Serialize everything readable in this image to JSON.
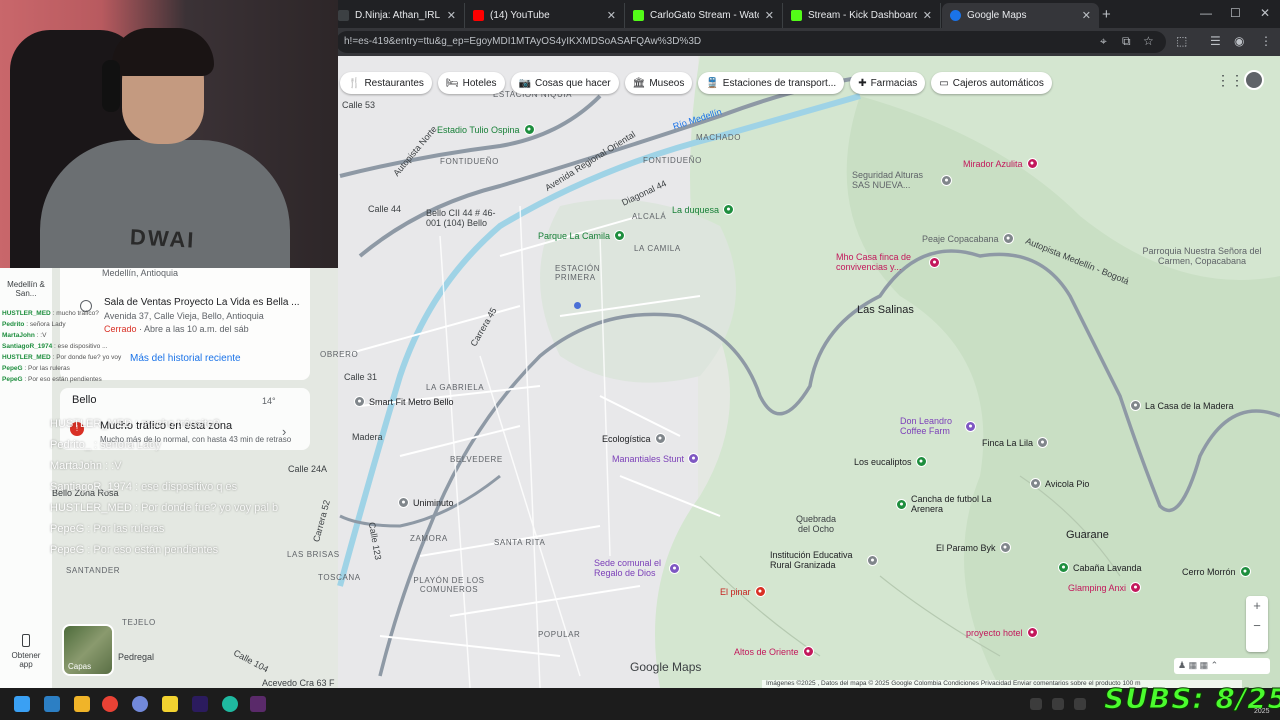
{
  "browser": {
    "tabs": [
      {
        "label": "D.Ninja: Athan_IRL",
        "color": "#3c4043"
      },
      {
        "label": "(14) YouTube",
        "color": "#ff0000"
      },
      {
        "label": "CarloGato Stream - Watch Live",
        "color": "#53fc18"
      },
      {
        "label": "Stream - Kick Dashboard",
        "color": "#53fc18"
      },
      {
        "label": "Google Maps",
        "color": "#1a73e8"
      }
    ],
    "url": "h!=es-419&entry=ttu&g_ep=EgoyMDI1MTAyOS4yIKXMDSoASAFQAw%3D%3D"
  },
  "chips": [
    {
      "label": "Restaurantes",
      "icon": "fork-knife-icon"
    },
    {
      "label": "Hoteles",
      "icon": "bed-icon"
    },
    {
      "label": "Cosas que hacer",
      "icon": "camera-icon"
    },
    {
      "label": "Museos",
      "icon": "museum-icon"
    },
    {
      "label": "Estaciones de transport...",
      "icon": "train-icon"
    },
    {
      "label": "Farmacias",
      "icon": "pharmacy-icon"
    },
    {
      "label": "Cajeros automáticos",
      "icon": "atm-icon"
    }
  ],
  "webcam": {
    "hoodie_text": "DWAI"
  },
  "panel": {
    "nav_label": "Medellín & San...",
    "history_top": "Medellín, Antioquia",
    "history_place": "Sala de Ventas Proyecto La Vida es Bella ...",
    "history_addr": "Avenida 37, Calle Vieja, Bello, Antioquia",
    "history_closed": "Cerrado",
    "history_hours": " · Abre a las 10 a.m. del sáb",
    "history_more": "Más del historial reciente",
    "traffic_city": "Bello",
    "traffic_temp": "14°",
    "traffic_title": "Mucho tráfico en esta zona",
    "traffic_sub": "Mucho más de lo normal, con hasta 43 min de retraso",
    "obtener": "Obtener app",
    "layers": "Capas"
  },
  "chat_small": [
    {
      "user": "HUSTLER_MED",
      "msg": "mucho tráfico?"
    },
    {
      "user": "Pedrito",
      "msg": "señora Lady"
    },
    {
      "user": "MartaJohn",
      "msg": ":V"
    },
    {
      "user": "SantiagoR_1974",
      "msg": "ese dispositivo ..."
    },
    {
      "user": "HUSTLER_MED",
      "msg": "Por donde fue? yo voy"
    },
    {
      "user": "PepeG",
      "msg": "Por las ruleras"
    },
    {
      "user": "PepeG",
      "msg": "Por eso están pendientes"
    }
  ],
  "chat_big": [
    {
      "user": "HUSTLER_MED",
      "msg": "mucho tránsito?"
    },
    {
      "user": "Pedrito_ ",
      "msg": "señora Lady"
    },
    {
      "user": "MartaJohn",
      "msg": ":V"
    },
    {
      "user": "SantiagoR_1974",
      "msg": "ese dispositivo q es"
    },
    {
      "user": "HUSTLER_MED",
      "msg": "Por donde fue? yo voy pal b"
    },
    {
      "user": "PepeG",
      "msg": "Por las ruleras"
    },
    {
      "user": "PepeG",
      "msg": "Por eso están pendientes"
    }
  ],
  "map": {
    "labels": [
      "Calle 53",
      "ESTACIÓN NIQUÍA",
      "FONTIDUEÑO",
      "FONTIDUEÑO",
      "MACHADO",
      "Río Medellín",
      "Avenida Regional Oriental",
      "Autopista Norte",
      "Diagonal 44",
      "ALCALÁ",
      "LA CAMILA",
      "ESTACIÓN PRIMERA",
      "Carrera 45",
      "LA GABRIELA",
      "Calle 44",
      "Calle 31",
      "OBRERO",
      "BELVEDERE",
      "ZAMORA",
      "SANTA RITA",
      "PLAYÓN DE LOS COMUNEROS",
      "LAS BRISAS",
      "SANTANDER",
      "TOSCANA",
      "POPULAR",
      "Calle 104",
      "Calle 123",
      "Carrera 52",
      "Madera",
      "Bello Zona Rosa",
      "TEJELO",
      "Pedregal",
      "Acevedo Cra 63 F",
      "Quebrada del Ocho",
      "Calle 24A",
      "Bello CII 44 # 46-001 (104) Bello",
      "Autopista Medellín - Bogotá"
    ],
    "towns": [
      "Las Salinas",
      "Guarane"
    ],
    "pois": [
      {
        "name": "Estadio Tulio Ospina",
        "kind": "green"
      },
      {
        "name": "La duquesa",
        "kind": "green"
      },
      {
        "name": "Parque La Camila",
        "kind": "green"
      },
      {
        "name": "Smart Fit Metro Bello",
        "kind": "gray"
      },
      {
        "name": "Ecologística",
        "kind": "gray"
      },
      {
        "name": "Manantiales Stunt",
        "kind": "purple"
      },
      {
        "name": "Uniminuto",
        "kind": "gray"
      },
      {
        "name": "Sede comunal el Regalo de Dios",
        "kind": "purple"
      },
      {
        "name": "Institución Educativa Rural Granizada",
        "kind": "gray"
      },
      {
        "name": "El pinar",
        "kind": "red"
      },
      {
        "name": "Altos de Oriente",
        "kind": "pink"
      },
      {
        "name": "Mirador Azulita",
        "kind": "pink"
      },
      {
        "name": "Seguridad Alturas SAS NUEVA...",
        "kind": "gray"
      },
      {
        "name": "Peaje Copacabana",
        "kind": "gray"
      },
      {
        "name": "Mho Casa finca de convivencias y...",
        "kind": "pink"
      },
      {
        "name": "Parroquia Nuestra Señora del Carmen, Copacabana",
        "kind": "gray"
      },
      {
        "name": "Don Leandro Coffee Farm",
        "kind": "purple"
      },
      {
        "name": "Finca La Lila",
        "kind": "gray"
      },
      {
        "name": "La Casa de la Madera",
        "kind": "gray"
      },
      {
        "name": "Los eucaliptos",
        "kind": "green"
      },
      {
        "name": "Cancha de futbol La Arenera",
        "kind": "green"
      },
      {
        "name": "Avicola Pio",
        "kind": "gray"
      },
      {
        "name": "El Paramo Byk",
        "kind": "gray"
      },
      {
        "name": "Cabaña Lavanda",
        "kind": "green"
      },
      {
        "name": "Glamping Anxi",
        "kind": "pink"
      },
      {
        "name": "Cerro Morrón",
        "kind": "green"
      },
      {
        "name": "proyecto hotel",
        "kind": "pink"
      }
    ],
    "logo": "Google Maps",
    "attribution": "Imágenes ©2025 , Datos del mapa © 2025 Google   Colombia   Condiciones   Privacidad   Enviar comentarios sobre el producto   100 m"
  },
  "overlay": {
    "subs": "SUBS: 8/25",
    "year": "2025"
  }
}
